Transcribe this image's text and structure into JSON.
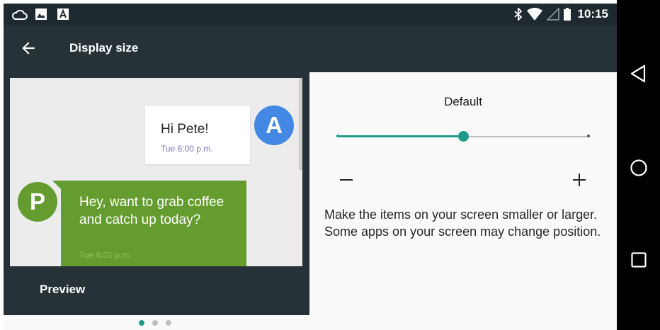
{
  "status_bar": {
    "time": "10:15",
    "left_icons": [
      "cloud-icon",
      "image-icon",
      "app-notification-icon"
    ],
    "right_icons": [
      "bluetooth-icon",
      "wifi-icon",
      "signal-icon",
      "battery-icon"
    ]
  },
  "toolbar": {
    "title": "Display size",
    "back_icon": "arrow-back-icon"
  },
  "preview": {
    "label": "Preview",
    "messages": [
      {
        "avatar": "A",
        "text": "Hi Pete!",
        "time": "Tue 6:00 p.m.",
        "avatar_color": "#4388e4"
      },
      {
        "avatar": "P",
        "text": "Hey, want to grab coffee and catch up today?",
        "time": "Tue 6:01 p.m.",
        "avatar_color": "#659c30"
      }
    ]
  },
  "pager": {
    "pages": 3,
    "current_page": 1
  },
  "settings": {
    "size_label": "Default",
    "slider": {
      "steps": 5,
      "current_step": 3
    },
    "minus_label": "−",
    "plus_label": "+",
    "description": "Make the items on your screen smaller or larger. Some apps on your screen may change position."
  },
  "nav_bar": {
    "icons": [
      "back-triangle-icon",
      "home-circle-icon",
      "recents-square-icon"
    ]
  },
  "colors": {
    "toolbar": "#263238",
    "status_bar": "#1f2a30",
    "accent": "#1e9b86",
    "avatar_a": "#4388e4",
    "bubble_p": "#659c30"
  }
}
